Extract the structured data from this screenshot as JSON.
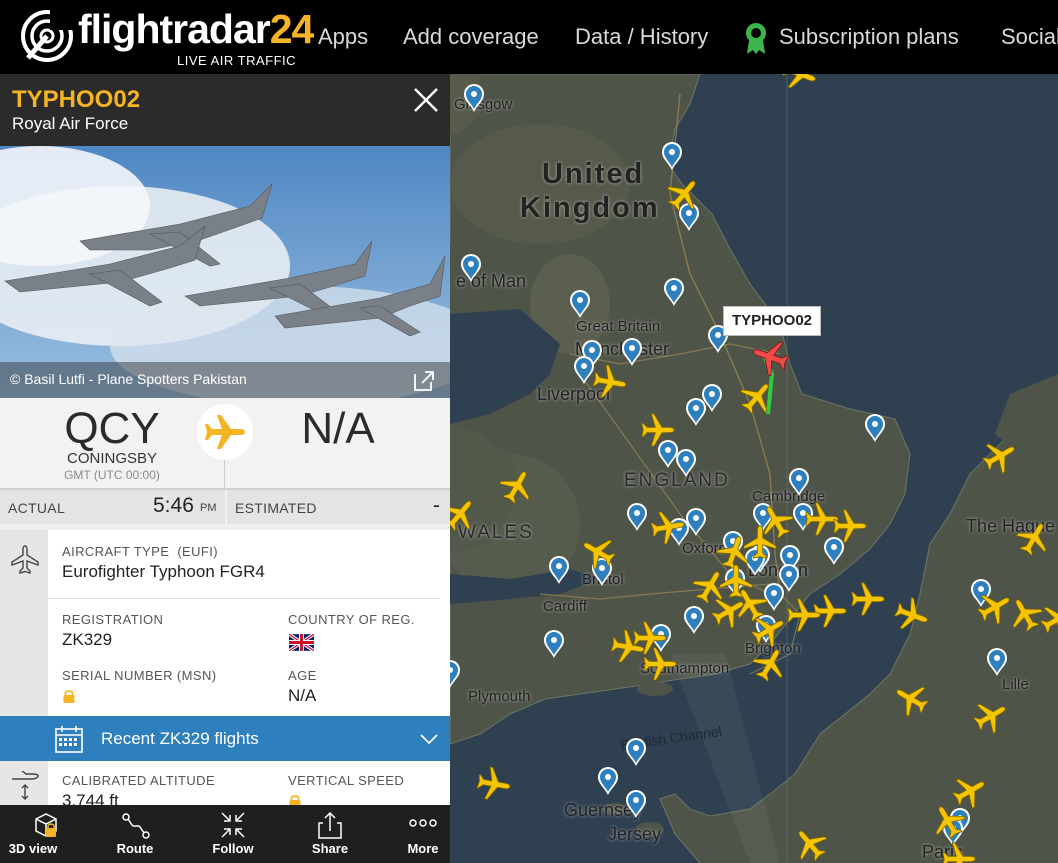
{
  "app": {
    "logo_text_main": "flightradar",
    "logo_text_accent": "24",
    "logo_tagline": "LIVE AIR TRAFFIC"
  },
  "nav": {
    "items": [
      {
        "label": "Apps"
      },
      {
        "label": "Add coverage"
      },
      {
        "label": "Data / History"
      },
      {
        "label": "Subscription plans"
      },
      {
        "label": "Social"
      }
    ]
  },
  "flight": {
    "callsign": "TYPHOO02",
    "airline": "Royal Air Force",
    "photo_credit": "© Basil Lutfi - Plane Spotters Pakistan",
    "origin": {
      "code": "QCY",
      "city": "CONINGSBY",
      "timezone": "GMT (UTC 00:00)"
    },
    "destination": {
      "code": "N/A"
    },
    "times": {
      "actual_label": "ACTUAL",
      "actual_value": "5:46",
      "actual_ampm": "PM",
      "estimated_label": "ESTIMATED",
      "estimated_value": "-"
    },
    "aircraft": {
      "type_label": "AIRCRAFT TYPE",
      "type_code": "(EUFI)",
      "type_value": "Eurofighter Typhoon FGR4",
      "registration_label": "REGISTRATION",
      "registration_value": "ZK329",
      "country_label": "COUNTRY OF REG.",
      "serial_label": "SERIAL NUMBER (MSN)",
      "age_label": "AGE",
      "age_value": "N/A"
    },
    "recent_flights_label": "Recent ZK329 flights",
    "altitude": {
      "calibrated_label": "CALIBRATED ALTITUDE",
      "calibrated_value": "3,744 ft",
      "vertical_label": "VERTICAL SPEED"
    }
  },
  "toolbar": {
    "items": [
      {
        "label": "3D view",
        "icon": "cube-lock-icon"
      },
      {
        "label": "Route",
        "icon": "route-icon"
      },
      {
        "label": "Follow",
        "icon": "follow-icon"
      },
      {
        "label": "Share",
        "icon": "share-icon"
      },
      {
        "label": "More",
        "icon": "more-icon"
      }
    ]
  },
  "map": {
    "labels": {
      "uk1": "United",
      "uk2": "Kingdom",
      "man": "e of Man",
      "great_britain": "Great Britain",
      "manchester": "Manchester",
      "liverpool": "Liverpool",
      "england": "ENGLAND",
      "wales": "WALES",
      "cambridge": "Cambridge",
      "hague": "The Hague",
      "glasgow": "Glasgow",
      "bristol": "Bristol",
      "cardiff": "Cardiff",
      "oxford": "Oxford",
      "london": "London",
      "southampton": "Southampton",
      "brighton": "Brighton",
      "plymouth": "Plymouth",
      "channel": "English Channel",
      "guernsey": "Guernsey",
      "jersey": "Jersey",
      "lille": "Lille",
      "paris": "Paris"
    },
    "selected_callout": "TYPHOO02",
    "colors": {
      "plane": "#f5c400",
      "selected_plane": "#f0494a",
      "pin": "#2e7fbe",
      "track": "#2ecc40"
    }
  },
  "colors": {
    "accent": "#f5b425",
    "header_bg": "#2b2b2b",
    "recent_bar": "#2e7fbe"
  }
}
